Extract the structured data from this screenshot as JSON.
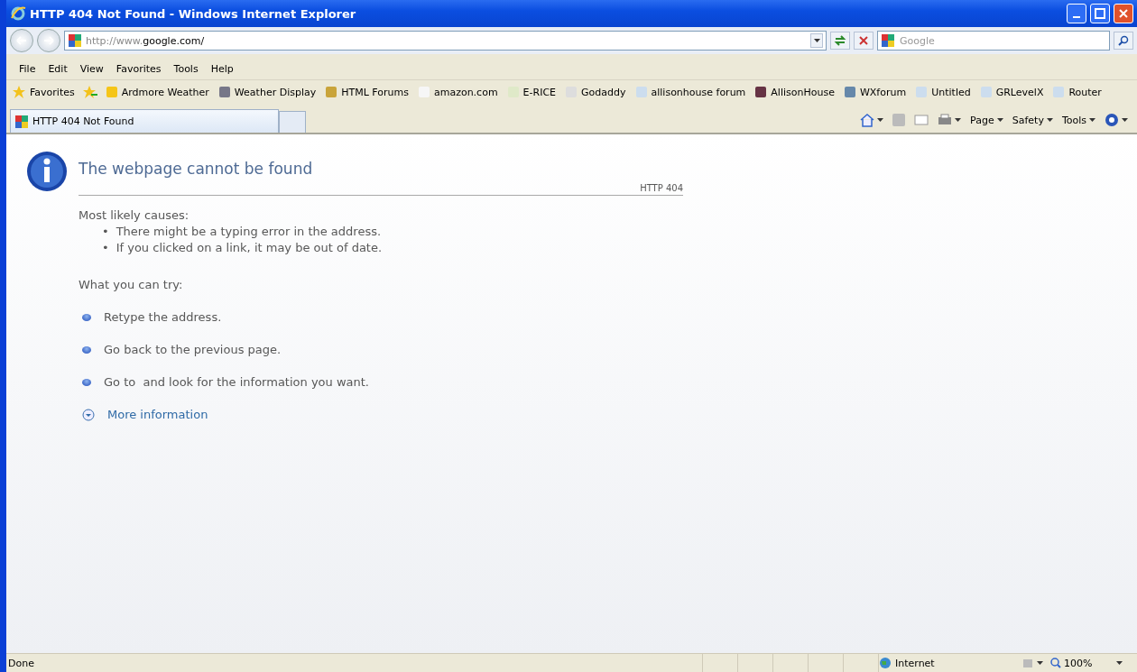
{
  "window": {
    "title": "HTTP 404 Not Found - Windows Internet Explorer"
  },
  "address_bar": {
    "value_prefix": "http://www.",
    "value_host": "google.com/"
  },
  "search": {
    "placeholder": "Google"
  },
  "menu": [
    "File",
    "Edit",
    "View",
    "Favorites",
    "Tools",
    "Help"
  ],
  "favorites_bar": {
    "label": "Favorites",
    "links": [
      "Ardmore Weather",
      "Weather Display",
      "HTML Forums",
      "amazon.com",
      "E-RICE",
      "Godaddy",
      "allisonhouse forum",
      "AllisonHouse",
      "WXforum",
      "Untitled",
      "GRLevelX",
      "Router"
    ]
  },
  "tabs": [
    {
      "label": "HTTP 404 Not Found",
      "selected": true
    }
  ],
  "command_bar": [
    "Page",
    "Safety",
    "Tools"
  ],
  "page": {
    "title": "The webpage cannot be found",
    "code": "HTTP 404",
    "causes_heading": "Most likely causes:",
    "causes": [
      {
        "bullet": "•",
        "text": "There might be a typing error in the address."
      },
      {
        "bullet": "•",
        "text": "If you clicked on a link, it may be out of date."
      }
    ],
    "try_heading": "What you can try:",
    "tries": [
      "Retype the address.",
      "Go back to the previous page.",
      "Go to  and look for the information you want."
    ],
    "more": "More information"
  },
  "status_bar": {
    "text": "Done",
    "zone": "Internet",
    "zoom": "100%"
  }
}
